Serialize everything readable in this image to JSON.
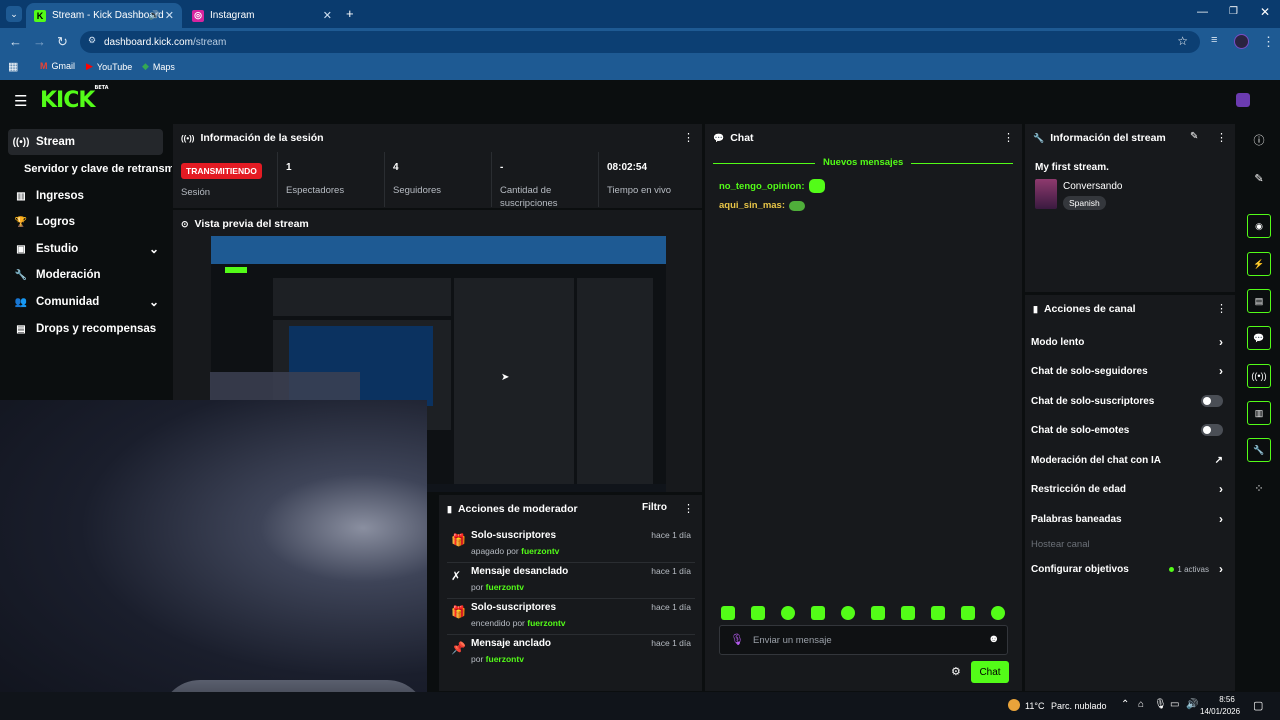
{
  "browser": {
    "tabs": [
      {
        "title": "Stream - Kick Dashboard",
        "active": true
      },
      {
        "title": "Instagram",
        "active": false
      }
    ],
    "url_domain": "dashboard.kick.com",
    "url_path": "/stream",
    "bookmarks": [
      "Gmail",
      "YouTube",
      "Maps"
    ]
  },
  "brand": {
    "logo": "KICK",
    "beta": "BETA",
    "accent": "#53fc18"
  },
  "sidebar": {
    "items": [
      {
        "label": "Stream",
        "icon": "broadcast-icon"
      },
      {
        "label": "Servidor y clave de retransm",
        "icon": ""
      },
      {
        "label": "Ingresos",
        "icon": "chart-icon"
      },
      {
        "label": "Logros",
        "icon": "trophy-icon"
      },
      {
        "label": "Estudio",
        "icon": "video-icon"
      },
      {
        "label": "Moderación",
        "icon": "wrench-icon"
      },
      {
        "label": "Comunidad",
        "icon": "community-icon"
      },
      {
        "label": "Drops y recompensas",
        "icon": "gift-icon"
      }
    ]
  },
  "session": {
    "title": "Información de la sesión",
    "status": "TRANSMITIENDO",
    "status_label": "Sesión",
    "stats": [
      {
        "value": "1",
        "label": "Espectadores"
      },
      {
        "value": "4",
        "label": "Seguidores"
      },
      {
        "value": "-",
        "label": "Cantidad de suscripciones"
      },
      {
        "value": "08:02:54",
        "label": "Tiempo en vivo"
      }
    ]
  },
  "preview": {
    "title": "Vista previa del stream"
  },
  "modactions": {
    "title": "Acciones de moderador",
    "filter": "Filtro",
    "items": [
      {
        "title": "Solo-suscriptores",
        "sub": "apagado por",
        "user": "fuerzontv",
        "time": "hace 1 día"
      },
      {
        "title": "Mensaje desanclado",
        "sub": "por",
        "user": "fuerzontv",
        "time": "hace 1 día"
      },
      {
        "title": "Solo-suscriptores",
        "sub": "encendido por",
        "user": "fuerzontv",
        "time": "hace 1 día"
      },
      {
        "title": "Mensaje anclado",
        "sub": "por",
        "user": "fuerzontv",
        "time": "hace 1 día"
      }
    ]
  },
  "chat": {
    "title": "Chat",
    "new_messages": "Nuevos mensajes",
    "messages": [
      {
        "user": "no_tengo_opinion:",
        "color": "#53fc18"
      },
      {
        "user": "aqui_sin_mas:",
        "color": "#e8c547"
      }
    ],
    "placeholder": "Enviar un mensaje",
    "send": "Chat"
  },
  "streaminfo": {
    "title": "Información del stream",
    "stream_title": "My first stream.",
    "category": "Conversando",
    "language": "Spanish"
  },
  "channel": {
    "title": "Acciones de canal",
    "rows": [
      {
        "label": "Modo lento",
        "control": "arrow"
      },
      {
        "label": "Chat de solo-seguidores",
        "control": "arrow"
      },
      {
        "label": "Chat de solo-suscriptores",
        "control": "toggle"
      },
      {
        "label": "Chat de solo-emotes",
        "control": "toggle"
      },
      {
        "label": "Moderación del chat con IA",
        "control": "external"
      },
      {
        "label": "Restricción de edad",
        "control": "arrow"
      },
      {
        "label": "Palabras baneadas",
        "control": "arrow"
      },
      {
        "label": "Hostear canal",
        "control": "disabled"
      },
      {
        "label": "Configurar objetivos",
        "control": "arrow"
      }
    ],
    "goals_active": "1 activas"
  },
  "taskbar": {
    "weather_temp": "11°C",
    "weather_text": "Parc. nublado",
    "time": "8:56",
    "date": "14/01/2026"
  }
}
